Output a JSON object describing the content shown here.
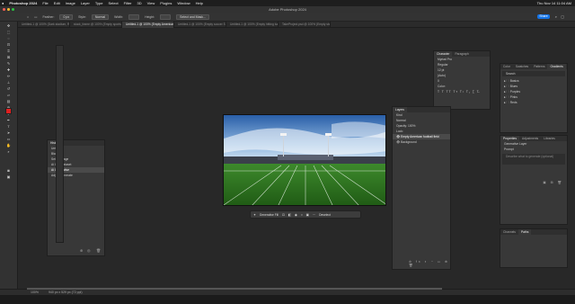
{
  "menubar": {
    "app_name": "Photoshop 2024",
    "items": [
      "File",
      "Edit",
      "Image",
      "Layer",
      "Type",
      "Select",
      "Filter",
      "3D",
      "View",
      "Plugins",
      "Window",
      "Help"
    ],
    "clock": "Thu Nov 14  11:04 AM"
  },
  "window": {
    "title": "Adobe Photoshop 2024"
  },
  "options": {
    "feather_label": "Feather:",
    "feather_value": "0 px",
    "style_label": "Style:",
    "style_value": "Normal",
    "width_label": "Width:",
    "height_label": "Height:",
    "select_mask_label": "Select and Mask...",
    "share_label": "Share"
  },
  "tabs": [
    {
      "label": "Untitled-1 @ 100% (Dark stadium, RGB/8)"
    },
    {
      "label": "stock_frame @ 100% (Empty sports turf in a view, RGB/8)"
    },
    {
      "label": "Untitled-1 @ 100% (Empty American football field, RGB/8)"
    },
    {
      "label": "Untitled-1 @ 100% (Empty soccer Stadium sega, RGB/8)"
    },
    {
      "label": "Untitled-1 @ 100% (Empty hitting turf, RGB/8)"
    },
    {
      "label": "TakeProject.psd @ 100% (Empty stadium, RGB/8)"
    }
  ],
  "status": {
    "zoom": "100%",
    "doc_size": "940 px x 529 px (72 ppi)"
  },
  "history_panel": {
    "tabs": [
      "History"
    ],
    "items": [
      "Untitled-1",
      "Blank 1",
      "Select Image",
      "Ai Gen Dataset",
      "Ai Generative",
      "Adjust Generate"
    ]
  },
  "character_panel": {
    "tabs": [
      "Character",
      "Paragraph"
    ],
    "font": "Myriad Pro",
    "style": "Regular",
    "size": "12 pt",
    "leading": "(Auto)",
    "tracking": "0",
    "color_label": "Color:"
  },
  "layers_panel": {
    "tabs": [
      "Layers"
    ],
    "kind_label": "Kind",
    "blend_mode": "Normal",
    "opacity_label": "Opacity: 100%",
    "lock_label": "Lock:",
    "fill_label": "Fill: 100%",
    "layers": [
      {
        "name": "Empty American football field",
        "selected": true
      },
      {
        "name": "Background",
        "selected": false
      }
    ]
  },
  "libraries_panel": {
    "tabs": [
      "Color",
      "Swatches",
      "Patterns",
      "Gradients"
    ],
    "search_placeholder": "Search",
    "groups": [
      "Basics",
      "Blues",
      "Purples",
      "Pinks",
      "Reds"
    ]
  },
  "properties_panel": {
    "tabs": [
      "Properties",
      "Adjustments",
      "Libraries"
    ],
    "pixel_label": "Generative Layer",
    "prompt_label": "Prompt",
    "prompt_placeholder": "Describe what to generate (optional)"
  },
  "channels_panel": {
    "tabs": [
      "Channels",
      "Paths"
    ]
  },
  "context_bar": {
    "generative_label": "Generative Fill",
    "deselect_label": "Deselect"
  },
  "colors": {
    "foreground": "#e02020",
    "background": "#ffffff",
    "accent": "#1473e6"
  }
}
